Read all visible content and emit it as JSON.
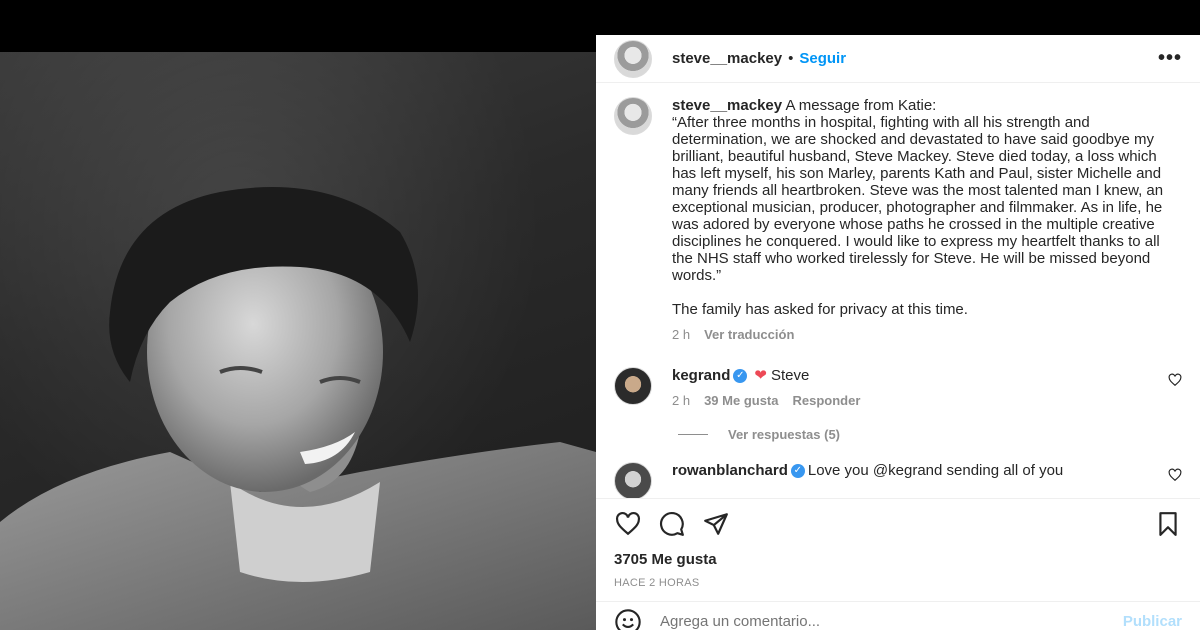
{
  "post": {
    "username": "steve__mackey",
    "separator": "•",
    "follow_label": "Seguir",
    "more_label": "•••"
  },
  "caption": {
    "username": "steve__mackey",
    "text": " A message from Katie:\n“After three months in hospital, fighting with all his strength and determination, we are shocked and devastated to have said goodbye my brilliant, beautiful husband, Steve Mackey. Steve died today, a loss which has left myself, his son Marley, parents Kath and Paul, sister Michelle and many friends all heartbroken. Steve was the most talented man I knew, an exceptional musician, producer, photographer and filmmaker. As in life, he was adored by everyone whose paths he crossed in the multiple creative disciplines he conquered. I would like to express my heartfelt thanks to all the NHS staff who worked tirelessly for Steve. He will be missed beyond words.”\n\nThe family has asked for privacy at this time.",
    "time": "2 h",
    "translate_label": "Ver traducción"
  },
  "comments": [
    {
      "username": "kegrand",
      "text": "Steve",
      "time": "2 h",
      "likes": "39 Me gusta",
      "reply_label": "Responder",
      "view_replies": "Ver respuestas (5)"
    },
    {
      "username": "rowanblanchard",
      "text": "Love you @kegrand sending all of you"
    }
  ],
  "actions": {
    "likes_count": "3705 Me gusta",
    "time_ago": "HACE 2 HORAS"
  },
  "add_comment": {
    "placeholder": "Agrega un comentario...",
    "publish_label": "Publicar"
  },
  "colors": {
    "accent": "#0095f6",
    "verified": "#3897f0",
    "heart": "#ed4956",
    "publish_disabled": "#b2dffc"
  },
  "icons": [
    "more-options-icon",
    "verified-icon",
    "heart-icon",
    "comment-icon",
    "share-icon",
    "bookmark-icon",
    "emoji-icon"
  ]
}
